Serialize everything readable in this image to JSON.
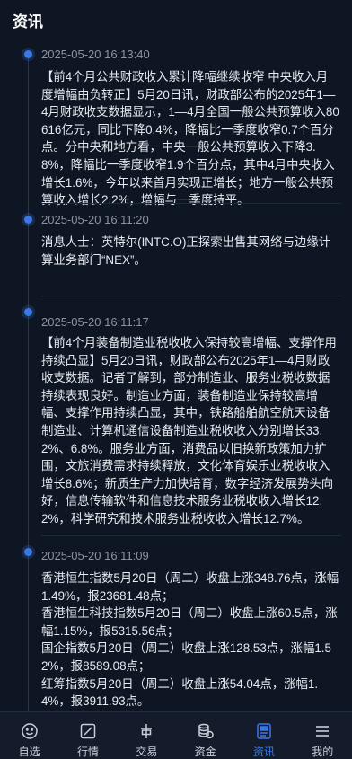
{
  "header": {
    "title": "资讯"
  },
  "news": [
    {
      "time": "2025-05-20 16:13:40",
      "content": "【前4个月公共财政收入累计降幅继续收窄 中央收入月度增幅由负转正】5月20日讯，财政部公布的2025年1—4月财政收支数据显示，1—4月全国一般公共预算收入80616亿元，同比下降0.4%，降幅比一季度收窄0.7个百分点。分中央和地方看，中央一般公共预算收入下降3.8%，降幅比一季度收窄1.9个百分点，其中4月中央收入增长1.6%，今年以来首月实现正增长；地方一般公共预算收入增长2.2%，增幅与一季度持平。"
    },
    {
      "time": "2025-05-20 16:11:20",
      "content": "消息人士：英特尔(INTC.O)正探索出售其网络与边缘计算业务部门“NEX”。"
    },
    {
      "time": "2025-05-20 16:11:17",
      "content": "【前4个月装备制造业税收收入保持较高增幅、支撑作用持续凸显】5月20日讯，财政部公布2025年1—4月财政收支数据。记者了解到，部分制造业、服务业税收数据持续表现良好。制造业方面，装备制造业保持较高增幅、支撑作用持续凸显，其中，铁路船舶航空航天设备制造业、计算机通信设备制造业税收收入分别增长33.2%、6.8%。服务业方面，消费品以旧换新政策加力扩围，文旅消费需求持续释放，文化体育娱乐业税收收入增长8.6%；新质生产力加快培育，数字经济发展势头向好，信息传输软件和信息技术服务业税收收入增长12.2%，科学研究和技术服务业税收收入增长12.7%。"
    },
    {
      "time": "2025-05-20 16:11:09",
      "content": "香港恒生指数5月20日（周二）收盘上涨348.76点，涨幅1.49%，报23681.48点；\n香港恒生科技指数5月20日（周二）收盘上涨60.5点，涨幅1.15%，报5315.56点；\n国企指数5月20日（周二）收盘上涨128.53点，涨幅1.52%，报8589.08点；\n红筹指数5月20日（周二）收盘上涨54.04点，涨幅1.4%，报3911.93点。"
    }
  ],
  "tabs": [
    {
      "label": "自选",
      "icon": "smiley-icon",
      "active": false
    },
    {
      "label": "行情",
      "icon": "chart-icon",
      "active": false
    },
    {
      "label": "交易",
      "icon": "trade-icon",
      "active": false
    },
    {
      "label": "资金",
      "icon": "coins-icon",
      "active": false
    },
    {
      "label": "资讯",
      "icon": "news-icon",
      "active": true
    },
    {
      "label": "我的",
      "icon": "menu-icon",
      "active": false
    }
  ],
  "colors": {
    "accent": "#3a78e6",
    "background": "#0e1624",
    "tabbar": "#141c2b"
  }
}
